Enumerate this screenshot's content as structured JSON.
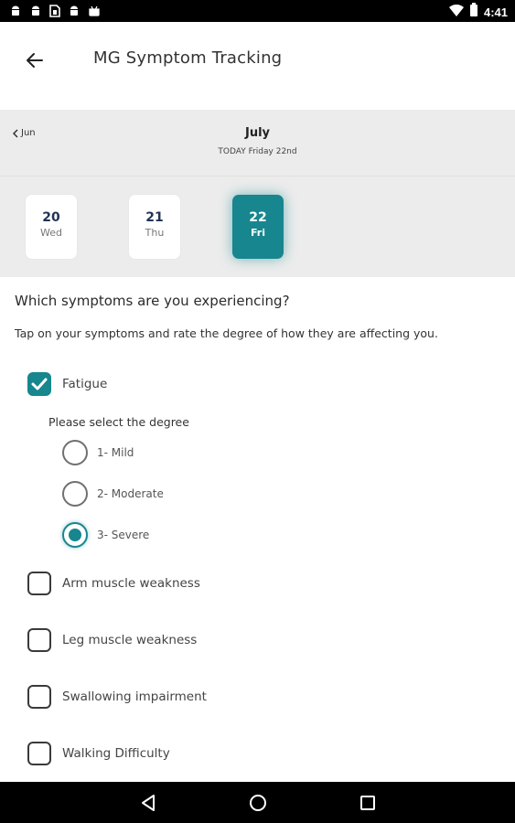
{
  "status_bar": {
    "time": "4:41",
    "left_icons": [
      "android-icon",
      "android-icon",
      "sim-card-icon",
      "android-icon",
      "android-icon"
    ],
    "right_icons": [
      "wifi-icon",
      "battery-icon"
    ]
  },
  "app_bar": {
    "title": "MG Symptom Tracking",
    "back_icon": "arrow-left-icon"
  },
  "calendar": {
    "prev_month": "Jun",
    "month": "July",
    "today_label": "TODAY Friday 22nd",
    "days": [
      {
        "num": "20",
        "dow": "Wed",
        "selected": false
      },
      {
        "num": "21",
        "dow": "Thu",
        "selected": false
      },
      {
        "num": "22",
        "dow": "Fri",
        "selected": true
      }
    ]
  },
  "form": {
    "question": "Which symptoms are you experiencing?",
    "instruction": "Tap on your symptoms and rate the degree of how they are affecting you.",
    "degree_prompt": "Please select the degree",
    "symptoms": [
      {
        "label": "Fatigue",
        "checked": true
      },
      {
        "label": "Arm muscle weakness",
        "checked": false
      },
      {
        "label": "Leg muscle weakness",
        "checked": false
      },
      {
        "label": "Swallowing impairment",
        "checked": false
      },
      {
        "label": "Walking Difficulty",
        "checked": false
      }
    ],
    "degrees": [
      {
        "label": "1- Mild",
        "selected": false
      },
      {
        "label": "2- Moderate",
        "selected": false
      },
      {
        "label": "3- Severe",
        "selected": true
      }
    ]
  },
  "nav_bar": {
    "icons": [
      "back-triangle-icon",
      "home-circle-icon",
      "recents-square-icon"
    ]
  },
  "colors": {
    "accent": "#17868f",
    "calendar_bg": "#ececec",
    "day_number": "#1f3354"
  }
}
